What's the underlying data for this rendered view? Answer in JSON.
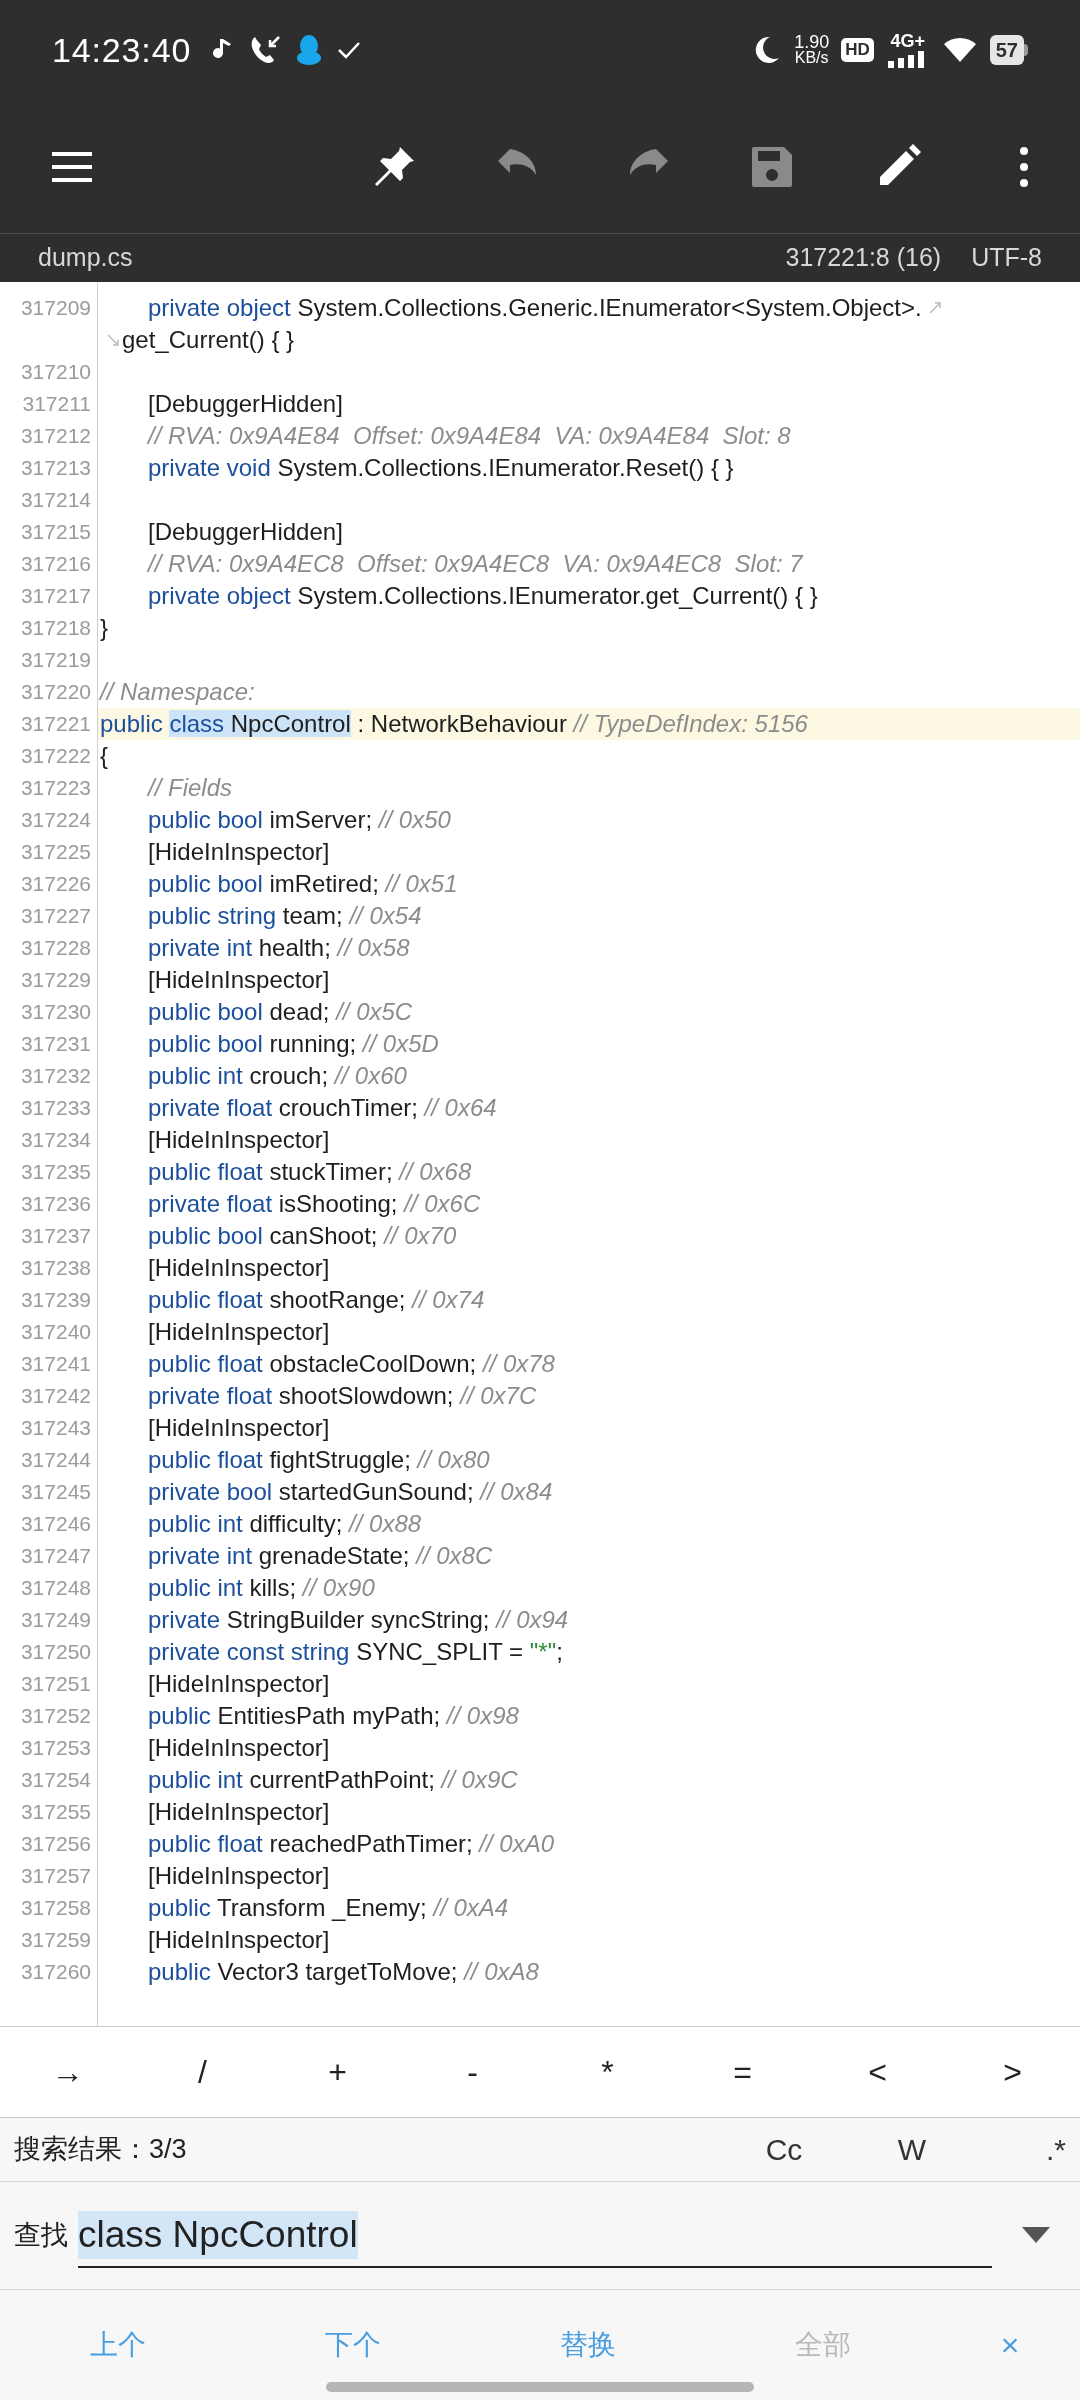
{
  "status_bar": {
    "time": "14:23:40",
    "speed_value": "1.90",
    "speed_unit": "KB/s",
    "hd_badge": "HD",
    "network": "4G+",
    "battery": "57"
  },
  "toolbar": [
    {
      "kind": "menu",
      "disabled": false
    },
    {
      "kind": "pin",
      "disabled": false
    },
    {
      "kind": "undo",
      "disabled": true
    },
    {
      "kind": "redo",
      "disabled": true
    },
    {
      "kind": "save",
      "disabled": true
    },
    {
      "kind": "edit",
      "disabled": false
    },
    {
      "kind": "more",
      "disabled": false
    }
  ],
  "file_bar": {
    "name": "dump.cs",
    "position": "317221:8 (16)",
    "encoding": "UTF-8"
  },
  "lines": [
    {
      "number": "317209",
      "indented": true,
      "current": false,
      "tokens": [
        {
          "kind": "keyword",
          "text": "private"
        },
        {
          "kind": "keyword",
          "text": "object"
        },
        {
          "kind": "plain",
          "text": "System.Collections.Generic.IEnumerator<System.Object>."
        }
      ],
      "continuation": [
        {
          "kind": "plain",
          "text": "get_Current()"
        },
        {
          "kind": "plain",
          "text": "{ }"
        }
      ]
    },
    {
      "number": "317210",
      "current": false
    },
    {
      "number": "317211",
      "indented": true,
      "current": false,
      "tokens": [
        {
          "kind": "plain",
          "text": "[DebuggerHidden]"
        }
      ]
    },
    {
      "number": "317212",
      "indented": true,
      "current": false,
      "tokens": [
        {
          "kind": "comment",
          "text": "// RVA: 0x9A4E84  Offset: 0x9A4E84  VA: 0x9A4E84  Slot: 8"
        }
      ]
    },
    {
      "number": "317213",
      "indented": true,
      "current": false,
      "tokens": [
        {
          "kind": "keyword",
          "text": "private"
        },
        {
          "kind": "keyword",
          "text": "void"
        },
        {
          "kind": "plain",
          "text": "System.Collections.IEnumerator.Reset()"
        },
        {
          "kind": "plain",
          "text": "{ }"
        }
      ]
    },
    {
      "number": "317214",
      "current": false
    },
    {
      "number": "317215",
      "indented": true,
      "current": false,
      "tokens": [
        {
          "kind": "plain",
          "text": "[DebuggerHidden]"
        }
      ]
    },
    {
      "number": "317216",
      "indented": true,
      "current": false,
      "tokens": [
        {
          "kind": "comment",
          "text": "// RVA: 0x9A4EC8  Offset: 0x9A4EC8  VA: 0x9A4EC8  Slot: 7"
        }
      ]
    },
    {
      "number": "317217",
      "indented": true,
      "current": false,
      "tokens": [
        {
          "kind": "keyword",
          "text": "private"
        },
        {
          "kind": "keyword",
          "text": "object"
        },
        {
          "kind": "plain",
          "text": "System.Collections.IEnumerator.get_Current()"
        },
        {
          "kind": "plain",
          "text": "{ }"
        }
      ]
    },
    {
      "number": "317218",
      "indented": false,
      "current": false,
      "tokens": [
        {
          "kind": "plain",
          "text": "}"
        }
      ]
    },
    {
      "number": "317219",
      "current": false
    },
    {
      "number": "317220",
      "indented": false,
      "current": false,
      "tokens": [
        {
          "kind": "comment",
          "text": "// Namespace:"
        }
      ]
    },
    {
      "number": "317221",
      "indented": false,
      "current": true,
      "tokens": [
        {
          "kind": "keyword",
          "text": "public",
          "match": false
        },
        {
          "kind": "keyword",
          "text": "class",
          "match": true
        },
        {
          "kind": "plain",
          "text": "NpcControl",
          "match": true
        },
        {
          "kind": "plain",
          "text": ": NetworkBehaviour",
          "match": false
        },
        {
          "kind": "comment",
          "text": "// TypeDefIndex: 5156",
          "match": false
        }
      ]
    },
    {
      "number": "317222",
      "indented": false,
      "current": false,
      "tokens": [
        {
          "kind": "plain",
          "text": "{"
        }
      ]
    },
    {
      "number": "317223",
      "indented": true,
      "current": false,
      "tokens": [
        {
          "kind": "comment",
          "text": "// Fields"
        }
      ]
    },
    {
      "number": "317224",
      "indented": true,
      "current": false,
      "tokens": [
        {
          "kind": "keyword",
          "text": "public"
        },
        {
          "kind": "keyword",
          "text": "bool"
        },
        {
          "kind": "plain",
          "text": "imServer;"
        },
        {
          "kind": "comment",
          "text": "// 0x50"
        }
      ]
    },
    {
      "number": "317225",
      "indented": true,
      "current": false,
      "tokens": [
        {
          "kind": "plain",
          "text": "[HideInInspector]"
        }
      ]
    },
    {
      "number": "317226",
      "indented": true,
      "current": false,
      "tokens": [
        {
          "kind": "keyword",
          "text": "public"
        },
        {
          "kind": "keyword",
          "text": "bool"
        },
        {
          "kind": "plain",
          "text": "imRetired;"
        },
        {
          "kind": "comment",
          "text": "// 0x51"
        }
      ]
    },
    {
      "number": "317227",
      "indented": true,
      "current": false,
      "tokens": [
        {
          "kind": "keyword",
          "text": "public"
        },
        {
          "kind": "keyword",
          "text": "string"
        },
        {
          "kind": "plain",
          "text": "team;"
        },
        {
          "kind": "comment",
          "text": "// 0x54"
        }
      ]
    },
    {
      "number": "317228",
      "indented": true,
      "current": false,
      "tokens": [
        {
          "kind": "keyword",
          "text": "private"
        },
        {
          "kind": "keyword",
          "text": "int"
        },
        {
          "kind": "plain",
          "text": "health;"
        },
        {
          "kind": "comment",
          "text": "// 0x58"
        }
      ]
    },
    {
      "number": "317229",
      "indented": true,
      "current": false,
      "tokens": [
        {
          "kind": "plain",
          "text": "[HideInInspector]"
        }
      ]
    },
    {
      "number": "317230",
      "indented": true,
      "current": false,
      "tokens": [
        {
          "kind": "keyword",
          "text": "public"
        },
        {
          "kind": "keyword",
          "text": "bool"
        },
        {
          "kind": "plain",
          "text": "dead;"
        },
        {
          "kind": "comment",
          "text": "// 0x5C"
        }
      ]
    },
    {
      "number": "317231",
      "indented": true,
      "current": false,
      "tokens": [
        {
          "kind": "keyword",
          "text": "public"
        },
        {
          "kind": "keyword",
          "text": "bool"
        },
        {
          "kind": "plain",
          "text": "running;"
        },
        {
          "kind": "comment",
          "text": "// 0x5D"
        }
      ]
    },
    {
      "number": "317232",
      "indented": true,
      "current": false,
      "tokens": [
        {
          "kind": "keyword",
          "text": "public"
        },
        {
          "kind": "keyword",
          "text": "int"
        },
        {
          "kind": "plain",
          "text": "crouch;"
        },
        {
          "kind": "comment",
          "text": "// 0x60"
        }
      ]
    },
    {
      "number": "317233",
      "indented": true,
      "current": false,
      "tokens": [
        {
          "kind": "keyword",
          "text": "private"
        },
        {
          "kind": "keyword",
          "text": "float"
        },
        {
          "kind": "plain",
          "text": "crouchTimer;"
        },
        {
          "kind": "comment",
          "text": "// 0x64"
        }
      ]
    },
    {
      "number": "317234",
      "indented": true,
      "current": false,
      "tokens": [
        {
          "kind": "plain",
          "text": "[HideInInspector]"
        }
      ]
    },
    {
      "number": "317235",
      "indented": true,
      "current": false,
      "tokens": [
        {
          "kind": "keyword",
          "text": "public"
        },
        {
          "kind": "keyword",
          "text": "float"
        },
        {
          "kind": "plain",
          "text": "stuckTimer;"
        },
        {
          "kind": "comment",
          "text": "// 0x68"
        }
      ]
    },
    {
      "number": "317236",
      "indented": true,
      "current": false,
      "tokens": [
        {
          "kind": "keyword",
          "text": "private"
        },
        {
          "kind": "keyword",
          "text": "float"
        },
        {
          "kind": "plain",
          "text": "isShooting;"
        },
        {
          "kind": "comment",
          "text": "// 0x6C"
        }
      ]
    },
    {
      "number": "317237",
      "indented": true,
      "current": false,
      "tokens": [
        {
          "kind": "keyword",
          "text": "public"
        },
        {
          "kind": "keyword",
          "text": "bool"
        },
        {
          "kind": "plain",
          "text": "canShoot;"
        },
        {
          "kind": "comment",
          "text": "// 0x70"
        }
      ]
    },
    {
      "number": "317238",
      "indented": true,
      "current": false,
      "tokens": [
        {
          "kind": "plain",
          "text": "[HideInInspector]"
        }
      ]
    },
    {
      "number": "317239",
      "indented": true,
      "current": false,
      "tokens": [
        {
          "kind": "keyword",
          "text": "public"
        },
        {
          "kind": "keyword",
          "text": "float"
        },
        {
          "kind": "plain",
          "text": "shootRange;"
        },
        {
          "kind": "comment",
          "text": "// 0x74"
        }
      ]
    },
    {
      "number": "317240",
      "indented": true,
      "current": false,
      "tokens": [
        {
          "kind": "plain",
          "text": "[HideInInspector]"
        }
      ]
    },
    {
      "number": "317241",
      "indented": true,
      "current": false,
      "tokens": [
        {
          "kind": "keyword",
          "text": "public"
        },
        {
          "kind": "keyword",
          "text": "float"
        },
        {
          "kind": "plain",
          "text": "obstacleCoolDown;"
        },
        {
          "kind": "comment",
          "text": "// 0x78"
        }
      ]
    },
    {
      "number": "317242",
      "indented": true,
      "current": false,
      "tokens": [
        {
          "kind": "keyword",
          "text": "private"
        },
        {
          "kind": "keyword",
          "text": "float"
        },
        {
          "kind": "plain",
          "text": "shootSlowdown;"
        },
        {
          "kind": "comment",
          "text": "// 0x7C"
        }
      ]
    },
    {
      "number": "317243",
      "indented": true,
      "current": false,
      "tokens": [
        {
          "kind": "plain",
          "text": "[HideInInspector]"
        }
      ]
    },
    {
      "number": "317244",
      "indented": true,
      "current": false,
      "tokens": [
        {
          "kind": "keyword",
          "text": "public"
        },
        {
          "kind": "keyword",
          "text": "float"
        },
        {
          "kind": "plain",
          "text": "fightStruggle;"
        },
        {
          "kind": "comment",
          "text": "// 0x80"
        }
      ]
    },
    {
      "number": "317245",
      "indented": true,
      "current": false,
      "tokens": [
        {
          "kind": "keyword",
          "text": "private"
        },
        {
          "kind": "keyword",
          "text": "bool"
        },
        {
          "kind": "plain",
          "text": "startedGunSound;"
        },
        {
          "kind": "comment",
          "text": "// 0x84"
        }
      ]
    },
    {
      "number": "317246",
      "indented": true,
      "current": false,
      "tokens": [
        {
          "kind": "keyword",
          "text": "public"
        },
        {
          "kind": "keyword",
          "text": "int"
        },
        {
          "kind": "plain",
          "text": "difficulty;"
        },
        {
          "kind": "comment",
          "text": "// 0x88"
        }
      ]
    },
    {
      "number": "317247",
      "indented": true,
      "current": false,
      "tokens": [
        {
          "kind": "keyword",
          "text": "private"
        },
        {
          "kind": "keyword",
          "text": "int"
        },
        {
          "kind": "plain",
          "text": "grenadeState;"
        },
        {
          "kind": "comment",
          "text": "// 0x8C"
        }
      ]
    },
    {
      "number": "317248",
      "indented": true,
      "current": false,
      "tokens": [
        {
          "kind": "keyword",
          "text": "public"
        },
        {
          "kind": "keyword",
          "text": "int"
        },
        {
          "kind": "plain",
          "text": "kills;"
        },
        {
          "kind": "comment",
          "text": "// 0x90"
        }
      ]
    },
    {
      "number": "317249",
      "indented": true,
      "current": false,
      "tokens": [
        {
          "kind": "keyword",
          "text": "private"
        },
        {
          "kind": "plain",
          "text": "StringBuilder syncString;"
        },
        {
          "kind": "comment",
          "text": "// 0x94"
        }
      ]
    },
    {
      "number": "317250",
      "indented": true,
      "current": false,
      "tokens": [
        {
          "kind": "keyword",
          "text": "private"
        },
        {
          "kind": "keyword",
          "text": "const"
        },
        {
          "kind": "keyword",
          "text": "string"
        },
        {
          "kind": "plain",
          "text": "SYNC_SPLIT ="
        },
        {
          "kind": "string",
          "text": "\"*\""
        },
        {
          "kind": "plain",
          "text": ";",
          "tight": true
        }
      ]
    },
    {
      "number": "317251",
      "indented": true,
      "current": false,
      "tokens": [
        {
          "kind": "plain",
          "text": "[HideInInspector]"
        }
      ]
    },
    {
      "number": "317252",
      "indented": true,
      "current": false,
      "tokens": [
        {
          "kind": "keyword",
          "text": "public"
        },
        {
          "kind": "plain",
          "text": "EntitiesPath myPath;"
        },
        {
          "kind": "comment",
          "text": "// 0x98"
        }
      ]
    },
    {
      "number": "317253",
      "indented": true,
      "current": false,
      "tokens": [
        {
          "kind": "plain",
          "text": "[HideInInspector]"
        }
      ]
    },
    {
      "number": "317254",
      "indented": true,
      "current": false,
      "tokens": [
        {
          "kind": "keyword",
          "text": "public"
        },
        {
          "kind": "keyword",
          "text": "int"
        },
        {
          "kind": "plain",
          "text": "currentPathPoint;"
        },
        {
          "kind": "comment",
          "text": "// 0x9C"
        }
      ]
    },
    {
      "number": "317255",
      "indented": true,
      "current": false,
      "tokens": [
        {
          "kind": "plain",
          "text": "[HideInInspector]"
        }
      ]
    },
    {
      "number": "317256",
      "indented": true,
      "current": false,
      "tokens": [
        {
          "kind": "keyword",
          "text": "public"
        },
        {
          "kind": "keyword",
          "text": "float"
        },
        {
          "kind": "plain",
          "text": "reachedPathTimer;"
        },
        {
          "kind": "comment",
          "text": "// 0xA0"
        }
      ]
    },
    {
      "number": "317257",
      "indented": true,
      "current": false,
      "tokens": [
        {
          "kind": "plain",
          "text": "[HideInInspector]"
        }
      ]
    },
    {
      "number": "317258",
      "indented": true,
      "current": false,
      "tokens": [
        {
          "kind": "keyword",
          "text": "public"
        },
        {
          "kind": "plain",
          "text": "Transform _Enemy;"
        },
        {
          "kind": "comment",
          "text": "// 0xA4"
        }
      ]
    },
    {
      "number": "317259",
      "indented": true,
      "current": false,
      "tokens": [
        {
          "kind": "plain",
          "text": "[HideInInspector]"
        }
      ]
    },
    {
      "number": "317260",
      "indented": true,
      "current": false,
      "tokens": [
        {
          "kind": "keyword",
          "text": "public"
        },
        {
          "kind": "plain",
          "text": "Vector3 targetToMove;"
        },
        {
          "kind": "comment",
          "text": "// 0xA8"
        }
      ]
    }
  ],
  "symbol_keys": [
    "→",
    "/",
    "+",
    "-",
    "*",
    "=",
    "<",
    ">"
  ],
  "search": {
    "result": "搜索结果：3/3",
    "options": [
      "Cc",
      "W",
      ".*"
    ],
    "find_label": "查找",
    "value": "class NpcControl",
    "value_selected": true
  },
  "actions": [
    {
      "label": "上个",
      "disabled": false
    },
    {
      "label": "下个",
      "disabled": false
    },
    {
      "label": "替换",
      "disabled": false
    },
    {
      "label": "全部",
      "disabled": true
    },
    {
      "label": "×",
      "disabled": false
    }
  ]
}
